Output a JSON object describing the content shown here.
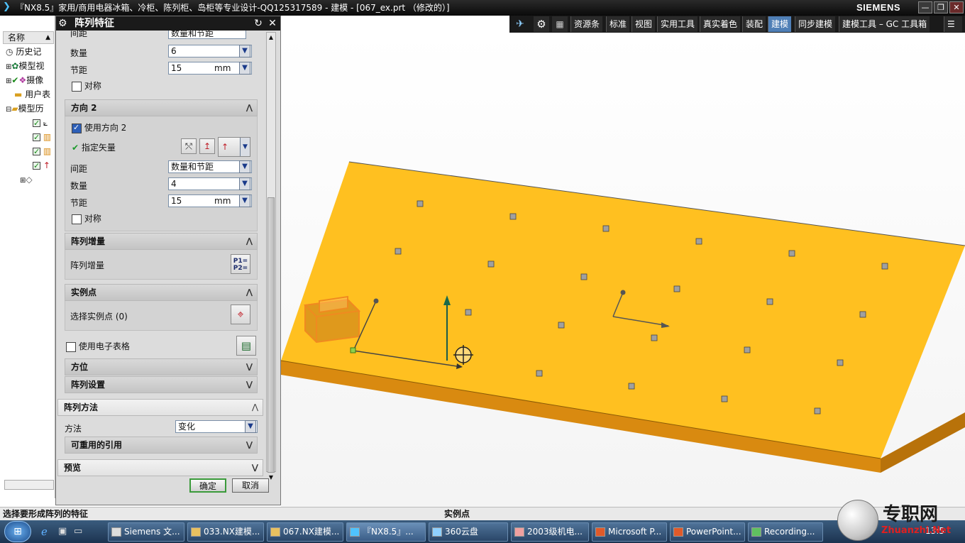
{
  "titlebar": {
    "title": "『NX8.5』家用/商用电器冰箱、冷柜、陈列柜、岛柜等专业设计-QQ125317589 - 建模 - [067_ex.prt （修改的）]",
    "brand": "SIEMENS",
    "minimize": "—",
    "restore": "❐",
    "close": "✕"
  },
  "toolbar": {
    "items": [
      "资源条",
      "标准",
      "视图",
      "实用工具",
      "真实着色",
      "装配",
      "建模",
      "同步建模",
      "建模工具 – GC 工具箱"
    ],
    "active": "建模"
  },
  "nav": {
    "header": "名称",
    "rows": [
      "历史记",
      "模型视",
      "摄像",
      "用户表",
      "模型历"
    ]
  },
  "dialog": {
    "title": "阵列特征",
    "top_partial": {
      "label": "间距",
      "value": "数量和节距"
    },
    "dir1": {
      "count_label": "数量",
      "count_value": "6",
      "pitch_label": "节距",
      "pitch_value": "15",
      "pitch_unit": "mm",
      "symmetric_label": "对称"
    },
    "dir2": {
      "header": "方向 2",
      "use_label": "使用方向 2",
      "vector_label": "指定矢量",
      "spacing_label": "间距",
      "spacing_value": "数量和节距",
      "count_label": "数量",
      "count_value": "4",
      "pitch_label": "节距",
      "pitch_value": "15",
      "pitch_unit": "mm",
      "symmetric_label": "对称"
    },
    "increment": {
      "header": "阵列增量",
      "label": "阵列增量",
      "icon_text": "P1=\nP2="
    },
    "instance": {
      "header": "实例点",
      "label": "选择实例点 (0)"
    },
    "spreadsheet_label": "使用电子表格",
    "orientation_header": "方位",
    "settings_header": "阵列设置",
    "method": {
      "header": "阵列方法",
      "label": "方法",
      "value": "变化"
    },
    "reuse_header": "可重用的引用",
    "preview_header": "预览",
    "ok": "确定",
    "cancel": "取消"
  },
  "status": {
    "left": "选择要形成阵列的特征",
    "middle": "实例点"
  },
  "taskbar": {
    "items": [
      "Siemens 文...",
      "033.NX建模...",
      "067.NX建模...",
      "『NX8.5』...",
      "360云盘",
      "2003级机电...",
      "Microsoft P...",
      "PowerPoint...",
      "Recording..."
    ],
    "clock": "13:5"
  },
  "watermark": {
    "cn": "专职网",
    "url": "Zhuanzhi.Net"
  },
  "colors": {
    "plate_top": "#FFC020",
    "plate_side": "#D98A10",
    "accent_active": "#4F7FB6",
    "highlight": "#F08A20"
  }
}
